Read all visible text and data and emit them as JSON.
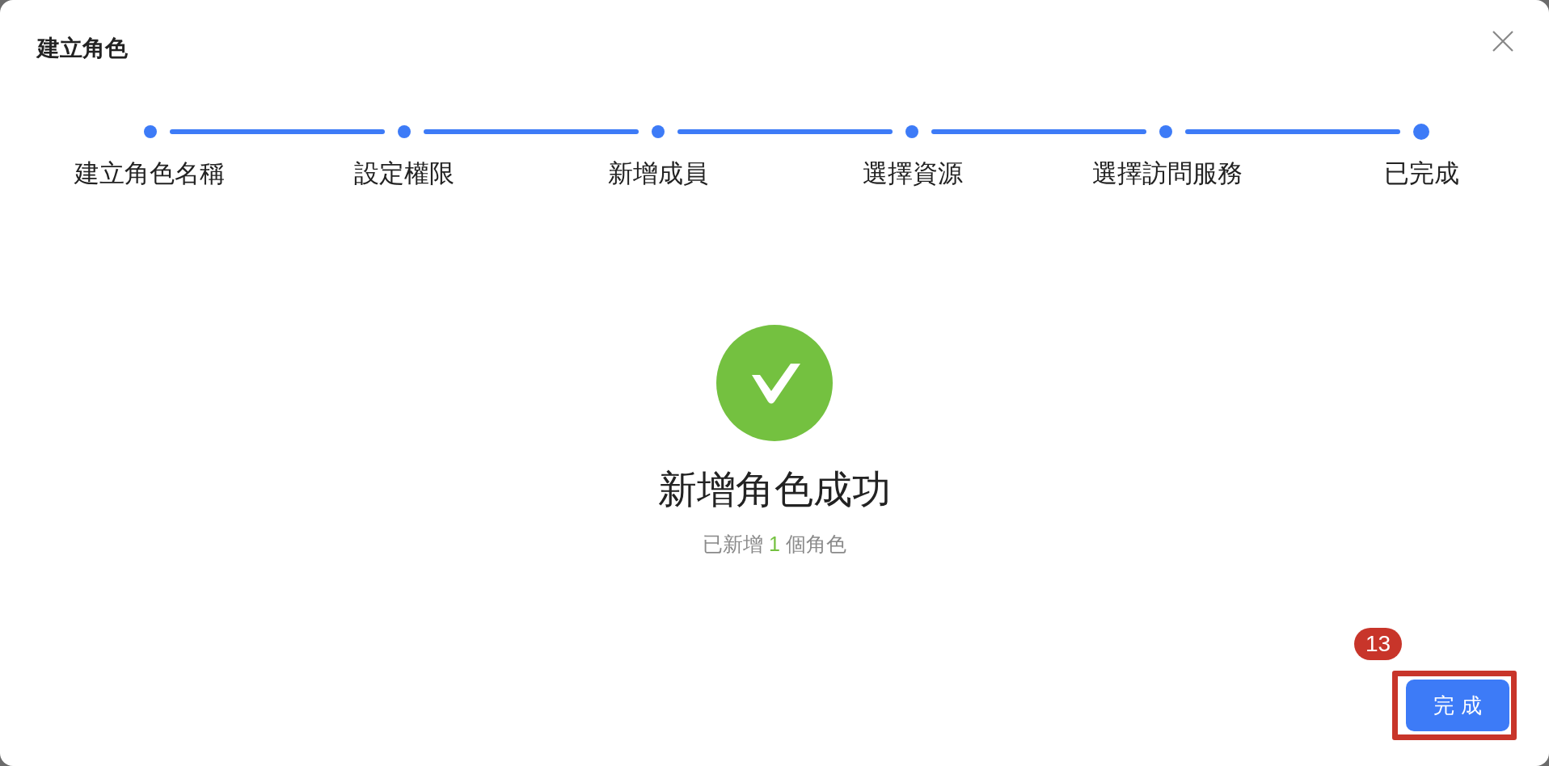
{
  "dialog": {
    "title": "建立角色"
  },
  "steps": [
    {
      "label": "建立角色名稱",
      "current": false
    },
    {
      "label": "設定權限",
      "current": false
    },
    {
      "label": "新增成員",
      "current": false
    },
    {
      "label": "選擇資源",
      "current": false
    },
    {
      "label": "選擇訪問服務",
      "current": false
    },
    {
      "label": "已完成",
      "current": true
    }
  ],
  "result": {
    "heading": "新增角色成功",
    "summary_before": "已新增",
    "count": "1",
    "summary_after": "個角色"
  },
  "button": {
    "label": "完 成"
  },
  "annotation": {
    "number": "13"
  }
}
